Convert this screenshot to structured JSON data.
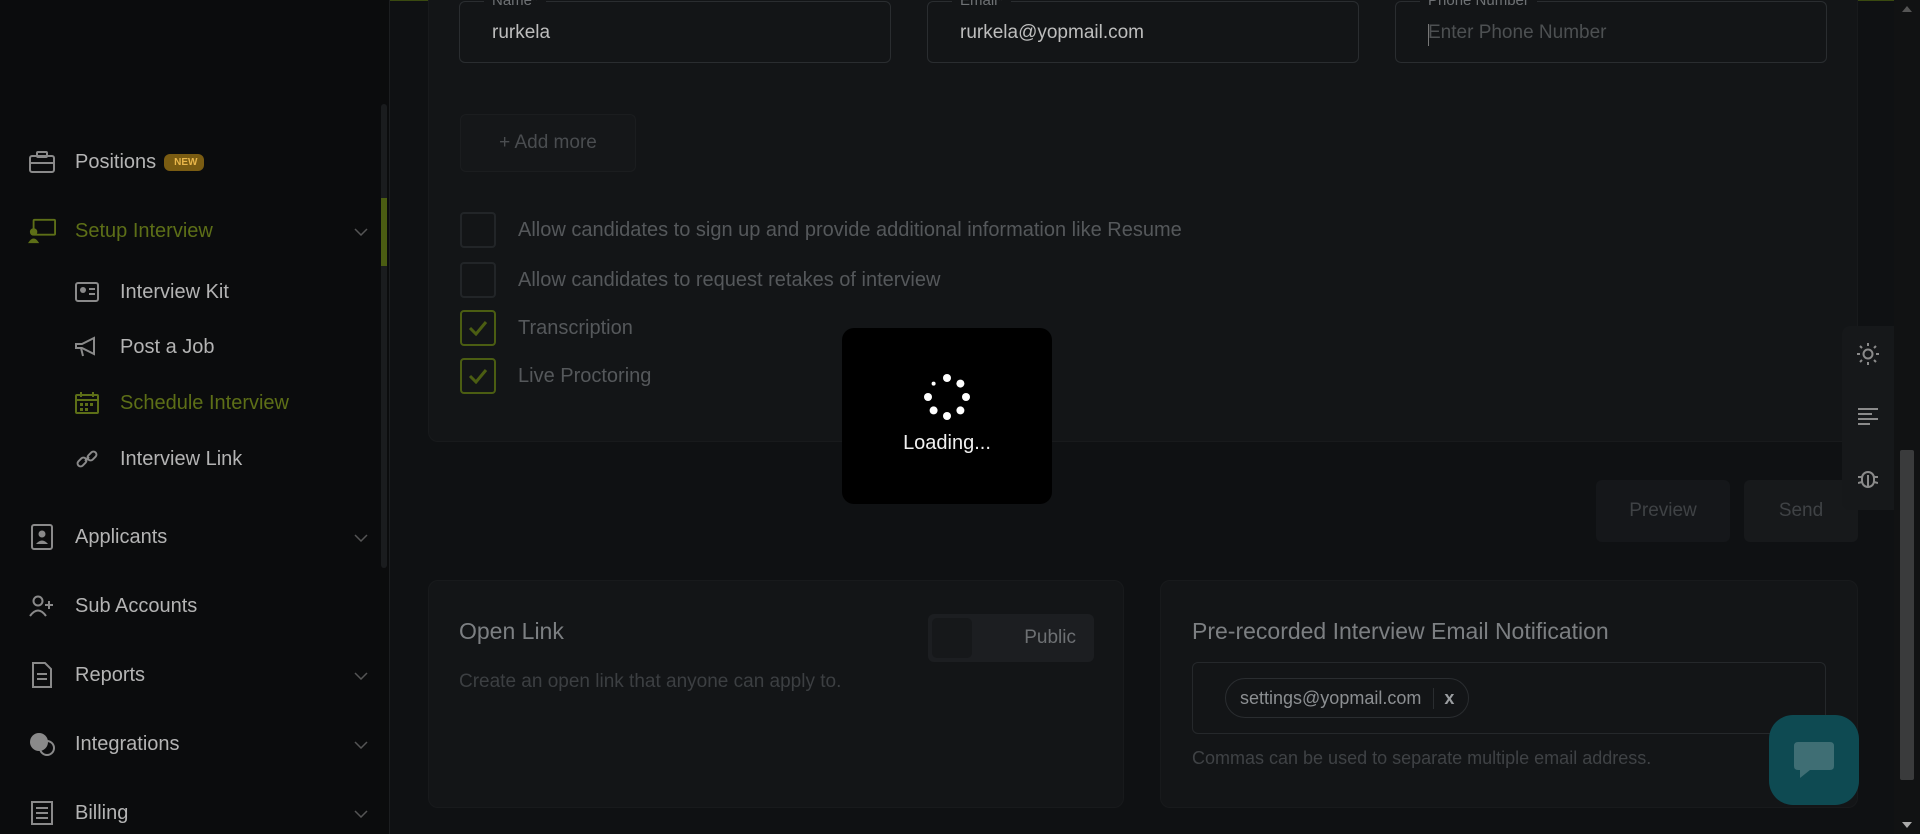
{
  "sidebar": {
    "items": [
      {
        "label": "Positions",
        "badge": "NEW"
      },
      {
        "label": "Setup Interview"
      },
      {
        "label": "Applicants"
      },
      {
        "label": "Sub Accounts"
      },
      {
        "label": "Reports"
      },
      {
        "label": "Integrations"
      },
      {
        "label": "Billing"
      }
    ],
    "subitems": [
      {
        "label": "Interview Kit"
      },
      {
        "label": "Post a Job"
      },
      {
        "label": "Schedule Interview"
      },
      {
        "label": "Interview Link"
      }
    ]
  },
  "form": {
    "name": {
      "legend": "Name*",
      "value": "rurkela"
    },
    "email": {
      "legend": "Email*",
      "value": "rurkela@yopmail.com"
    },
    "phone": {
      "legend": "Phone Number",
      "placeholder": "Enter Phone Number"
    },
    "add_more": "+ Add more",
    "options": [
      {
        "label": "Allow candidates to sign up and provide additional information like Resume",
        "checked": false
      },
      {
        "label": "Allow candidates to request retakes of interview",
        "checked": false
      },
      {
        "label": "Transcription",
        "checked": true
      },
      {
        "label": "Live Proctoring",
        "checked": true
      }
    ],
    "preview_label": "Preview",
    "send_label": "Send"
  },
  "open_link": {
    "title": "Open Link",
    "description": "Create an open link that anyone can apply to.",
    "toggle_label": "Public"
  },
  "notification": {
    "title": "Pre-recorded Interview Email Notification",
    "chip": "settings@yopmail.com",
    "chip_remove": "x",
    "hint": "Commas can be used to separate multiple email address."
  },
  "loader": {
    "text": "Loading..."
  },
  "colors": {
    "accent": "#5d6f17",
    "chat": "#0e4a52"
  }
}
